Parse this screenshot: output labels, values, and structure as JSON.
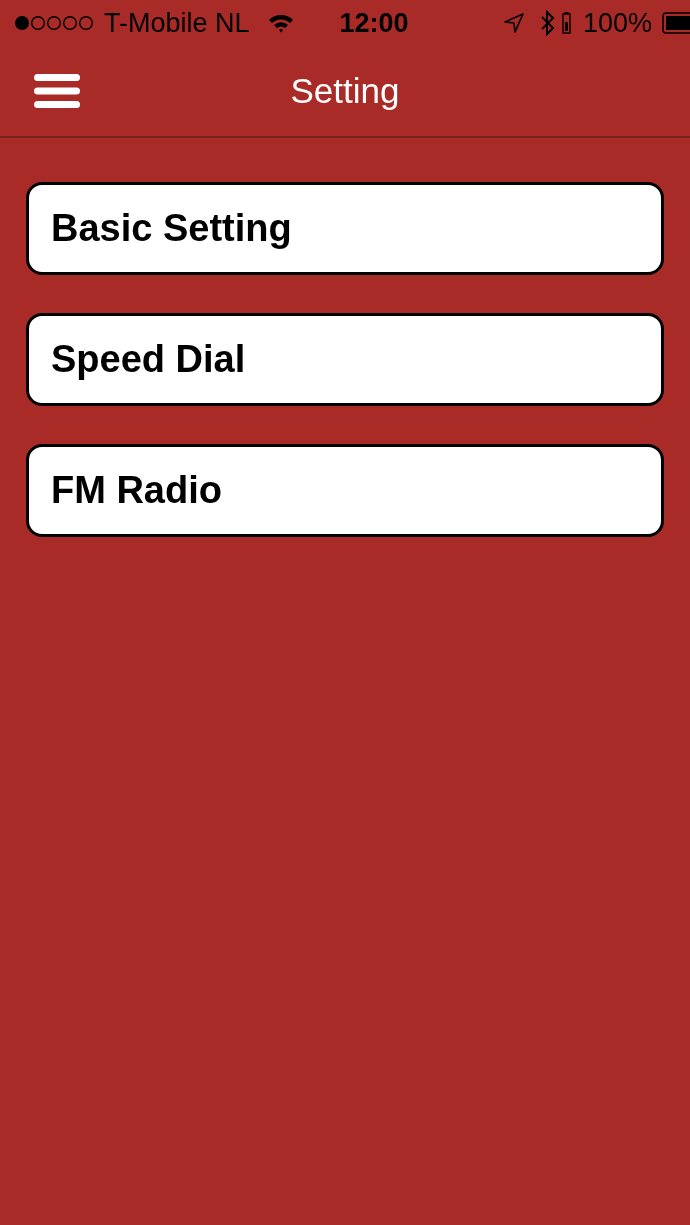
{
  "status_bar": {
    "carrier": "T-Mobile NL",
    "time": "12:00",
    "battery": "100%"
  },
  "nav_bar": {
    "title": "Setting"
  },
  "menu_items": [
    {
      "label": "Basic Setting"
    },
    {
      "label": "Speed Dial"
    },
    {
      "label": "FM Radio"
    }
  ]
}
